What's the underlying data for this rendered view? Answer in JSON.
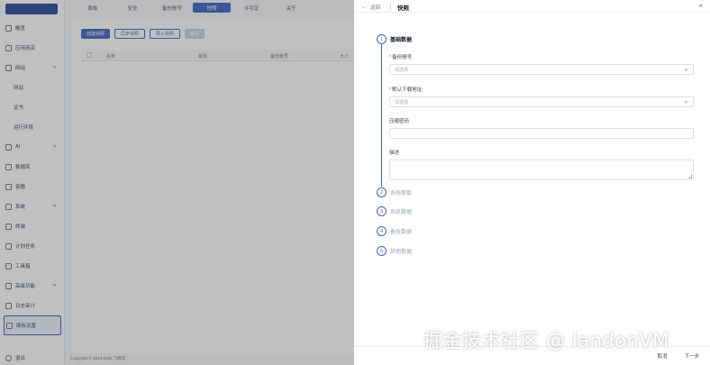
{
  "sidebar": {
    "logo_text": "",
    "items": [
      {
        "label": "概览",
        "icon": "home-icon"
      },
      {
        "label": "应用商店",
        "icon": "store-icon"
      },
      {
        "label": "网站",
        "icon": "globe-icon",
        "expandable": true
      },
      {
        "label": "网站",
        "sub": true
      },
      {
        "label": "证书",
        "sub": true
      },
      {
        "label": "运行环境",
        "sub": true
      },
      {
        "label": "AI",
        "icon": "ai-icon",
        "expandable": true
      },
      {
        "label": "数据库",
        "icon": "database-icon"
      },
      {
        "label": "容器",
        "icon": "container-icon"
      },
      {
        "label": "系统",
        "icon": "system-icon",
        "expandable": true
      },
      {
        "label": "终端",
        "icon": "terminal-icon"
      },
      {
        "label": "计划任务",
        "icon": "clock-icon"
      },
      {
        "label": "工具箱",
        "icon": "toolbox-icon"
      },
      {
        "label": "高级功能",
        "icon": "star-icon",
        "expandable": true
      },
      {
        "label": "日志审计",
        "icon": "log-icon"
      },
      {
        "label": "面板设置",
        "icon": "gear-icon",
        "active": true
      }
    ],
    "user_label": "退出"
  },
  "main": {
    "tabs": [
      {
        "label": "面板"
      },
      {
        "label": "安全"
      },
      {
        "label": "备份账号"
      },
      {
        "label": "快照",
        "active": true
      },
      {
        "label": "许可证"
      },
      {
        "label": "关于"
      }
    ],
    "actions": {
      "create": "创建快照",
      "sync": "同步快照",
      "import": "导入快照",
      "delete": "删除"
    },
    "table_headers": {
      "name": "名称",
      "version": "版本",
      "account": "备份账号",
      "size": "大小"
    },
    "copyright": "Copyright © 2014-2025 飞致云"
  },
  "drawer": {
    "back_label": "返回",
    "title": "快照",
    "close": "×",
    "steps": [
      {
        "num": "1",
        "label": "基础数据"
      },
      {
        "num": "2",
        "label": "系统面板"
      },
      {
        "num": "3",
        "label": "系统数据"
      },
      {
        "num": "4",
        "label": "备份数据"
      },
      {
        "num": "5",
        "label": "其他数据"
      }
    ],
    "fields": {
      "backup_account_label": "备份账号",
      "backup_account_placeholder": "请选择",
      "download_label": "默认下载地址",
      "download_placeholder": "请选择",
      "password_label": "压缩密码",
      "description_label": "描述"
    },
    "footer": {
      "cancel": "取消",
      "next": "下一步"
    }
  },
  "watermark": "掘金技术社区 @ landonVM",
  "colors": {
    "accent": "#3b63c4",
    "sidebar_active_bg": "#eef2fb",
    "overlay": "rgba(60,60,60,0.32)"
  }
}
